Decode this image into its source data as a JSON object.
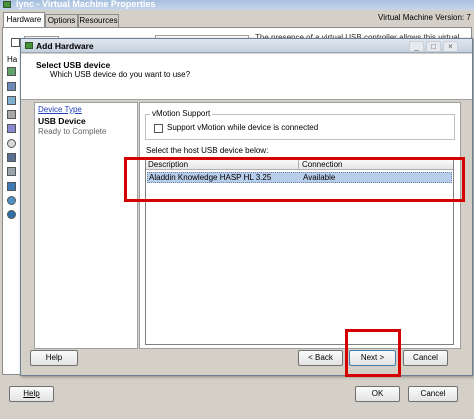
{
  "outer": {
    "title": "lync - Virtual Machine Properties",
    "tabs": [
      "Hardware",
      "Options",
      "Resources"
    ],
    "vm_version_label": "Virtual Machine Version: 7",
    "snippet": "The presence of a virtual USB controller allows this virtual",
    "left_stub": "Ha",
    "help_label": "Help",
    "ok_label": "OK",
    "cancel_label": "Cancel"
  },
  "dialog": {
    "title": "Add Hardware",
    "header_title": "Select USB device",
    "header_subtitle": "Which USB device do you want to use?",
    "steps": [
      "Device Type",
      "USB Device",
      "Ready to Complete"
    ],
    "vmotion_group_label": "vMotion Support",
    "vmotion_checkbox_label": "Support vMotion while device is connected",
    "host_device_label": "Select the host USB device below:",
    "columns": [
      "Description",
      "Connection"
    ],
    "rows": [
      {
        "description": "Aladdin Knowledge HASP HL 3.25",
        "connection": "Available"
      }
    ],
    "help_label": "Help",
    "back_label": "< Back",
    "next_label": "Next >",
    "cancel_label": "Cancel"
  },
  "colors": {
    "highlight": "#d40000",
    "dialog_title_bar": "#ced8e4",
    "selected_row": "#b8cde9",
    "link": "#1f3fbf"
  }
}
